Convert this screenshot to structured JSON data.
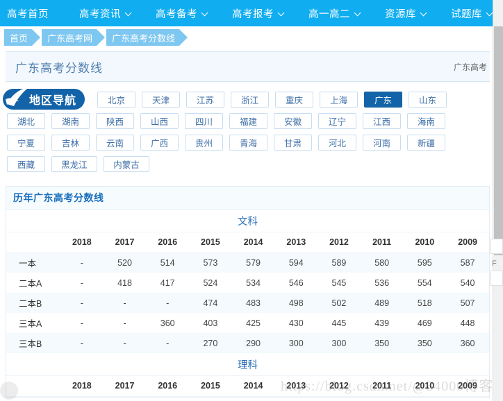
{
  "topnav": {
    "items": [
      {
        "label": "高考首页",
        "has_caret": false
      },
      {
        "label": "高考资讯",
        "has_caret": true
      },
      {
        "label": "高考备考",
        "has_caret": true
      },
      {
        "label": "高考报考",
        "has_caret": true
      },
      {
        "label": "高一高二",
        "has_caret": true
      },
      {
        "label": "资源库",
        "has_caret": true
      },
      {
        "label": "试题库",
        "has_caret": true
      }
    ]
  },
  "breadcrumb": {
    "items": [
      "首页",
      "广东高考网",
      "广东高考分数线"
    ]
  },
  "page_header": {
    "title": "广东高考分数线",
    "right_text": "广东高考"
  },
  "region_nav": {
    "heading": "地区导航",
    "icon": "swoosh-arrow-icon",
    "active": "广东",
    "rows": [
      [
        "北京",
        "天津",
        "江苏",
        "浙江",
        "重庆",
        "上海",
        "广东",
        "山东"
      ],
      [
        "湖北",
        "湖南",
        "陕西",
        "山西",
        "四川",
        "福建",
        "安徽",
        "辽宁",
        "江西",
        "海南"
      ],
      [
        "宁夏",
        "吉林",
        "云南",
        "广西",
        "贵州",
        "青海",
        "甘肃",
        "河北",
        "河南",
        "新疆"
      ],
      [
        "西藏",
        "黑龙江",
        "内蒙古"
      ]
    ]
  },
  "score_card": {
    "title": "历年广东高考分数线",
    "sections": [
      {
        "name": "文科",
        "columns": [
          "",
          "2018",
          "2017",
          "2016",
          "2015",
          "2014",
          "2013",
          "2012",
          "2011",
          "2010",
          "2009"
        ],
        "rows": [
          {
            "label": "一本",
            "values": [
              "-",
              "520",
              "514",
              "573",
              "579",
              "594",
              "589",
              "580",
              "595",
              "587"
            ]
          },
          {
            "label": "二本A",
            "values": [
              "-",
              "418",
              "417",
              "524",
              "534",
              "546",
              "545",
              "536",
              "554",
              "540"
            ]
          },
          {
            "label": "二本B",
            "values": [
              "-",
              "-",
              "-",
              "474",
              "483",
              "498",
              "502",
              "489",
              "518",
              "507"
            ]
          },
          {
            "label": "三本A",
            "values": [
              "-",
              "-",
              "360",
              "403",
              "425",
              "430",
              "445",
              "439",
              "469",
              "448"
            ]
          },
          {
            "label": "三本B",
            "values": [
              "-",
              "-",
              "-",
              "270",
              "290",
              "300",
              "300",
              "350",
              "350",
              "360"
            ]
          }
        ]
      },
      {
        "name": "理科",
        "columns": [
          "",
          "2018",
          "2017",
          "2016",
          "2015",
          "2014",
          "2013",
          "2012",
          "2011",
          "2010",
          "2009"
        ],
        "rows": []
      }
    ]
  },
  "watermark": {
    "text": "https://blog.csdn.net/@54000博客"
  },
  "colors": {
    "nav_blue": "#10adf0",
    "crumb_blue": "#7ec7f0",
    "active_blue": "#1363a8",
    "title_blue": "#2b6fb5",
    "panel_tint": "#f2f8fd"
  }
}
